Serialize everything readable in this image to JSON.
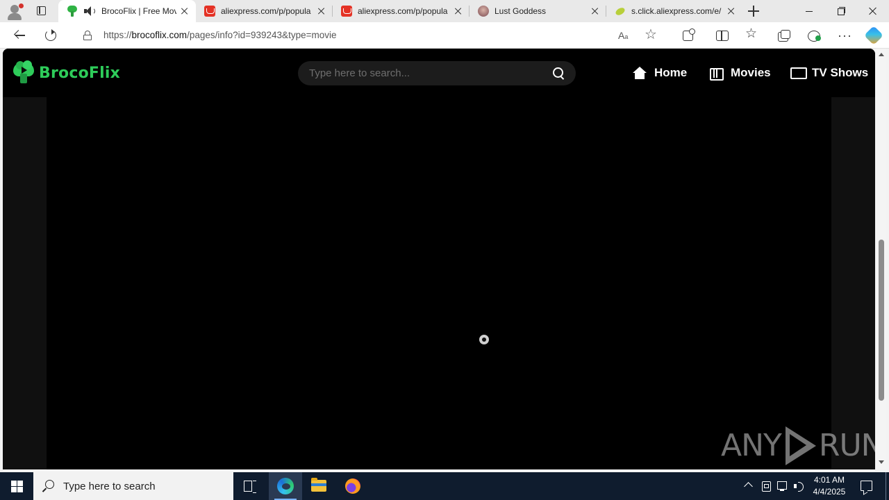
{
  "browser": {
    "tabs": [
      {
        "title": "BrocoFlix | Free Mov",
        "favicon": "broccoli-icon",
        "active": true,
        "audio": true
      },
      {
        "title": "aliexpress.com/p/popula",
        "favicon": "aliexpress-icon",
        "active": false
      },
      {
        "title": "aliexpress.com/p/popula",
        "favicon": "aliexpress-icon",
        "active": false
      },
      {
        "title": "Lust Goddess",
        "favicon": "lust-goddess-icon",
        "active": false
      },
      {
        "title": "s.click.aliexpress.com/e/",
        "favicon": "leaf-icon",
        "active": false
      }
    ],
    "url_prefix": "https://",
    "url_domain": "brocoflix.com",
    "url_path": "/pages/info?id=939243&type=movie",
    "read_aloud_label": "A",
    "read_aloud_sup": "a"
  },
  "site": {
    "logo_text": "BrocoFlix",
    "brand_color": "#2ecc5a",
    "search_placeholder": "Type here to search...",
    "nav": {
      "home": "Home",
      "movies": "Movies",
      "tv_shows": "TV Shows"
    }
  },
  "watermark": {
    "left": "ANY",
    "right": "RUN"
  },
  "taskbar": {
    "search_placeholder": "Type here to search",
    "time": "4:01 AM",
    "date": "4/4/2025"
  }
}
